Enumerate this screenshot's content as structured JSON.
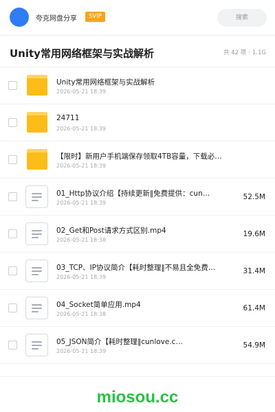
{
  "header": {
    "share_name": "夸克网盘分享",
    "badge": "SVIP",
    "search_label": "搜索"
  },
  "folder": {
    "title": "Unity常用网络框架与实战解析",
    "count": "共 42 项",
    "total_size": "1.1G"
  },
  "items": [
    {
      "type": "folder",
      "icon": "folder-icon",
      "name": "Unity常用网络框架与实战解析",
      "date": "2026-05-21 18:39",
      "size": ""
    },
    {
      "type": "folder",
      "icon": "folder-icon",
      "name": "24711",
      "date": "2026-05-21 18:39",
      "size": ""
    },
    {
      "type": "folder",
      "icon": "folder-icon",
      "name": "【限时】新用户手机端保存领取4TB容量，下载必看！…",
      "date": "2026-05-21 18:39",
      "size": ""
    },
    {
      "type": "file",
      "icon": "document-icon",
      "name": "01_Http协议介绍【持续更新‖免费提供：cun…",
      "date": "2026-05-21 18:39",
      "size": "52.5M"
    },
    {
      "type": "file",
      "icon": "document-icon",
      "name": "02_Get和Post请求方式区别.mp4",
      "date": "2026-05-21 18:38",
      "size": "19.6M"
    },
    {
      "type": "file",
      "icon": "document-icon",
      "name": "03_TCP、IP协议简介【耗时整理‖不易且全免费…",
      "date": "2026-05-21 18:39",
      "size": "31.4M"
    },
    {
      "type": "file",
      "icon": "document-icon",
      "name": "04_Socket简单应用.mp4",
      "date": "2026-05-21 18:38",
      "size": "61.4M"
    },
    {
      "type": "file",
      "icon": "document-icon",
      "name": "05_JSON简介【耗时整理‖cunlove.c…",
      "date": "2026-05-21 18:39",
      "size": "54.9M"
    }
  ],
  "watermark": "miosou.cc",
  "colors": {
    "accent_blue": "#2f7cf6",
    "svip_orange": "#f5a523",
    "folder_yellow": "#fbbd18",
    "watermark_green": "#27c244"
  }
}
